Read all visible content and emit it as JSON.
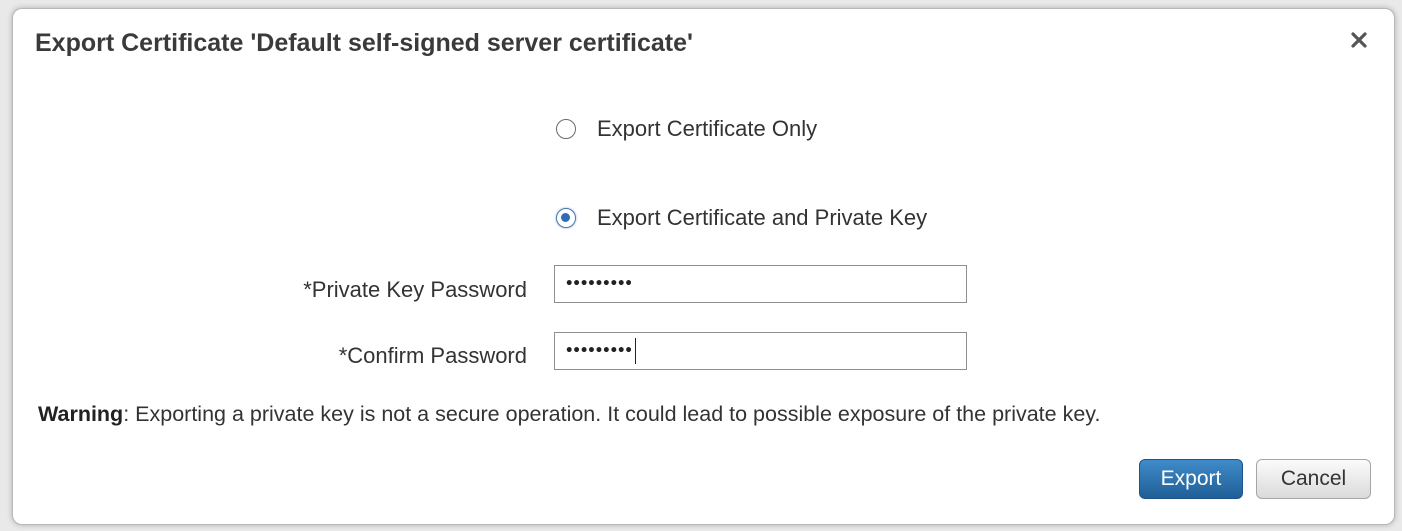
{
  "dialog": {
    "title": "Export Certificate 'Default self-signed server certificate'",
    "close_icon": "close-icon"
  },
  "options": [
    {
      "label": "Export Certificate Only",
      "checked": false
    },
    {
      "label": "Export Certificate and Private Key",
      "checked": true
    }
  ],
  "fields": {
    "private_key_password": {
      "label": "*Private Key Password",
      "value": "•••••••••"
    },
    "confirm_password": {
      "label": "*Confirm Password",
      "value": "•••••••••"
    }
  },
  "warning": {
    "prefix": "Warning",
    "text": ": Exporting a private key is not a secure operation. It could lead to possible exposure of the private key."
  },
  "buttons": {
    "export_label": "Export",
    "cancel_label": "Cancel"
  },
  "colors": {
    "primary_button": "#2f6fa8",
    "radio_selected": "#2f6db5"
  }
}
